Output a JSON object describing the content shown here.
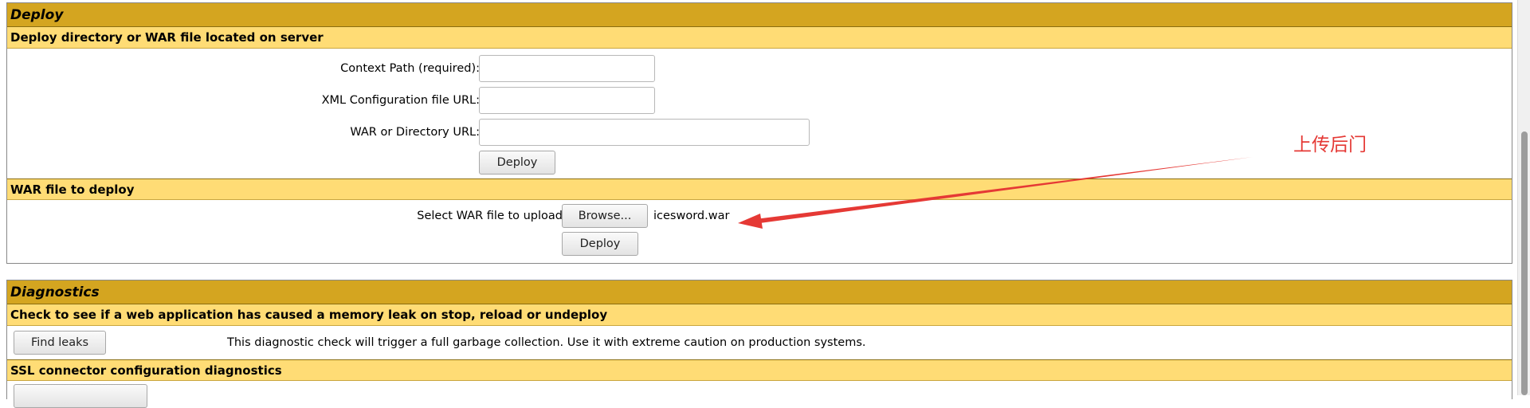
{
  "deploy": {
    "title": "Deploy",
    "server_section": {
      "heading": "Deploy directory or WAR file located on server",
      "context_path_label": "Context Path (required):",
      "context_path_value": "",
      "xml_config_label": "XML Configuration file URL:",
      "xml_config_value": "",
      "war_dir_label": "WAR or Directory URL:",
      "war_dir_value": "",
      "deploy_button": "Deploy"
    },
    "war_section": {
      "heading": "WAR file to deploy",
      "select_label": "Select WAR file to upload",
      "browse_button": "Browse...",
      "selected_file": "icesword.war",
      "deploy_button": "Deploy"
    }
  },
  "diagnostics": {
    "title": "Diagnostics",
    "memory_leak": {
      "heading": "Check to see if a web application has caused a memory leak on stop, reload or undeploy",
      "find_leaks_button": "Find leaks",
      "description": "This diagnostic check will trigger a full garbage collection. Use it with extreme caution on production systems."
    },
    "ssl": {
      "heading": "SSL connector configuration diagnostics"
    }
  },
  "annotation": {
    "text": "上传后门",
    "color": "#e53935"
  },
  "colors": {
    "title_bar": "#d4a520",
    "subheading_bar": "#ffdc75"
  }
}
